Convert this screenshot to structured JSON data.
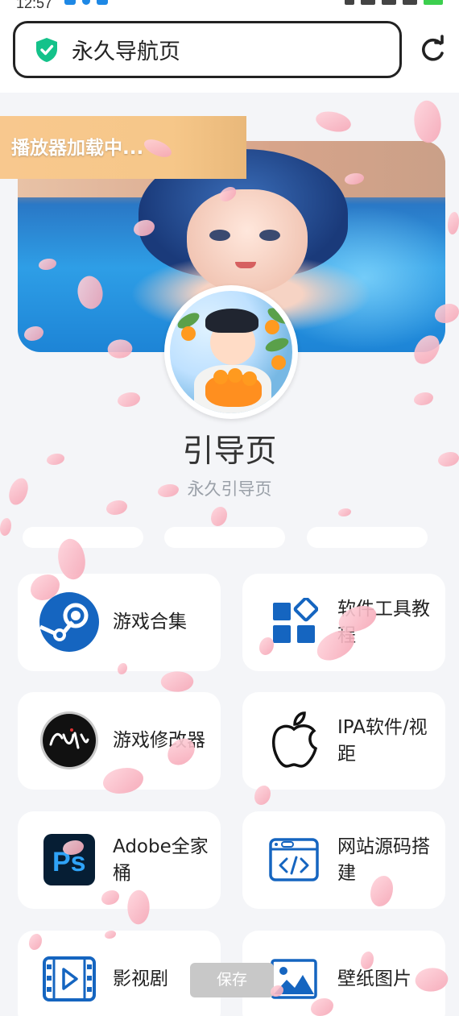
{
  "status_bar": {
    "time": "12:57"
  },
  "address_bar": {
    "url_text": "永久导航页"
  },
  "banner": {
    "loading_text": "播放器加载中..."
  },
  "profile": {
    "title": "引导页",
    "subtitle": "永久引导页"
  },
  "grid": [
    {
      "label": "游戏合集",
      "icon": "steam-icon"
    },
    {
      "label": "软件工具教程",
      "icon": "apps-grid-icon"
    },
    {
      "label": "游戏修改器",
      "icon": "fengying-logo-icon"
    },
    {
      "label": "IPA软件/视距",
      "icon": "apple-icon"
    },
    {
      "label": "Adobe全家桶",
      "icon": "photoshop-icon"
    },
    {
      "label": "网站源码搭建",
      "icon": "code-browser-icon"
    },
    {
      "label": "影视剧",
      "icon": "video-icon"
    },
    {
      "label": "壁纸图片",
      "icon": "image-icon"
    }
  ],
  "save_button": {
    "label": "保存"
  },
  "colors": {
    "accent_blue": "#1565c0",
    "loading_bg": "#f6c789",
    "page_bg": "#f4f5f8"
  }
}
